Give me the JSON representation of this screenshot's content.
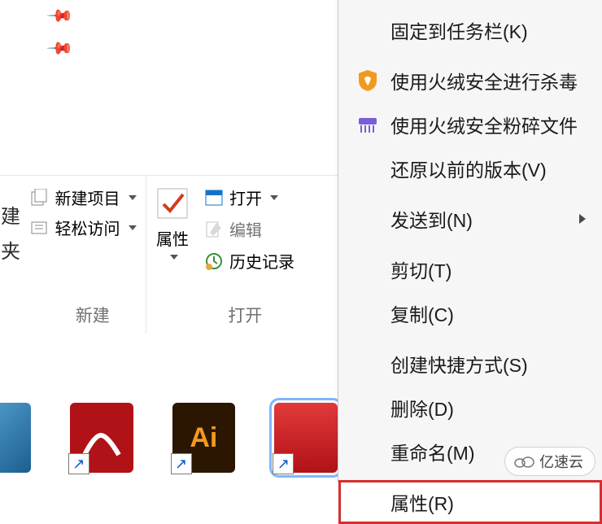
{
  "ribbon": {
    "group_new": {
      "label": "新建",
      "new_item": "新建项目",
      "easy_access": "轻松访问",
      "left_cut_top": "建",
      "left_cut_bottom": "夹"
    },
    "group_open": {
      "label": "打开",
      "properties": "属性",
      "open_btn": "打开",
      "edit": "编辑",
      "history": "历史记录"
    }
  },
  "context_menu": {
    "pin_taskbar": "固定到任务栏(K)",
    "huorong_virus": "使用火绒安全进行杀毒",
    "huorong_shred": "使用火绒安全粉碎文件",
    "restore_prev": "还原以前的版本(V)",
    "send_to": "发送到(N)",
    "cut": "剪切(T)",
    "copy": "复制(C)",
    "create_shortcut": "创建快捷方式(S)",
    "delete": "删除(D)",
    "rename": "重命名(M)",
    "properties": "属性(R)"
  },
  "icons": {
    "shield": "shield-icon",
    "shredder": "shredder-icon",
    "new_item": "new-item-icon",
    "easy_access": "easy-access-icon",
    "properties": "checkmark-icon",
    "open_blue": "open-window-icon",
    "edit": "edit-icon",
    "history": "history-icon",
    "shortcut_arrow": "↗"
  },
  "desktop": {
    "adobe_reader": "Adobe Reader",
    "illustrator": "Ai"
  },
  "watermark": "亿速云"
}
